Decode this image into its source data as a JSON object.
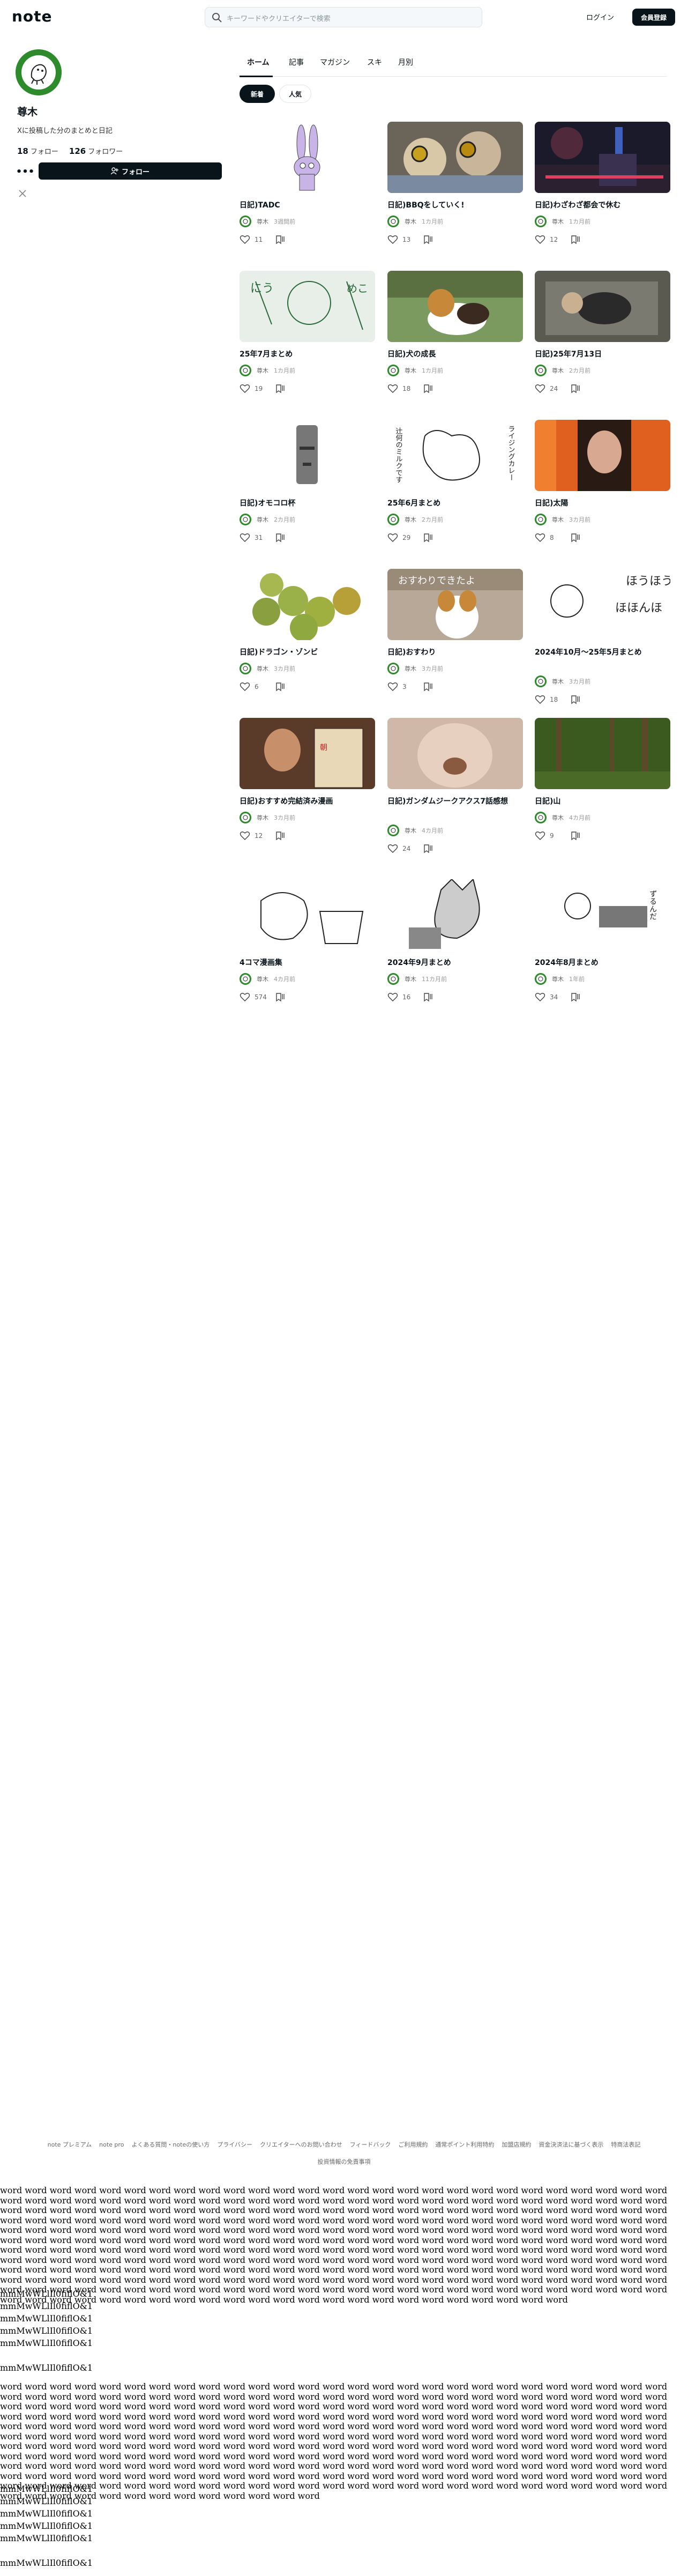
{
  "header": {
    "logo": "note",
    "search_placeholder": "キーワードやクリエイターで検索",
    "login": "ログイン",
    "signup": "会員登録"
  },
  "profile": {
    "name": "尊木",
    "bio": "Xに投稿した分のまとめと日記",
    "following_count": "18",
    "following_label": "フォロー",
    "followers_count": "126",
    "followers_label": "フォロワー",
    "more": "•••",
    "follow_button": "フォロー"
  },
  "tabs": [
    "ホーム",
    "記事",
    "マガジン",
    "スキ",
    "月別"
  ],
  "filters": [
    "新着",
    "人気"
  ],
  "author": "尊木",
  "cards": [
    {
      "title": "日記)TADC",
      "time": "3週間前",
      "likes": "11",
      "thumb": "rabbit"
    },
    {
      "title": "日記)BBQをしていく!",
      "time": "1カ月前",
      "likes": "13",
      "thumb": "bbq"
    },
    {
      "title": "日記)わざわざ都会で休む",
      "time": "1カ月前",
      "likes": "12",
      "thumb": "city"
    },
    {
      "title": "25年7月まとめ",
      "time": "1カ月前",
      "likes": "19",
      "thumb": "sketch"
    },
    {
      "title": "日記)犬の成長",
      "time": "1カ月前",
      "likes": "18",
      "thumb": "dog"
    },
    {
      "title": "日記)25年7月13日",
      "time": "2カ月前",
      "likes": "24",
      "thumb": "table"
    },
    {
      "title": "日記)オモコロ杯",
      "time": "2カ月前",
      "likes": "31",
      "thumb": "moai"
    },
    {
      "title": "25年6月まとめ",
      "time": "2カ月前",
      "likes": "29",
      "thumb": "manga1"
    },
    {
      "title": "日記)太陽",
      "time": "3カ月前",
      "likes": "8",
      "thumb": "sun"
    },
    {
      "title": "日記)ドラゴン・ゾンビ",
      "time": "3カ月前",
      "likes": "6",
      "thumb": "fruit"
    },
    {
      "title": "日記)おすわり",
      "time": "3カ月前",
      "likes": "3",
      "thumb": "puppy"
    },
    {
      "title": "2024年10月〜25年5月まとめ",
      "time": "3カ月前",
      "likes": "18",
      "thumb": "manga2"
    },
    {
      "title": "日記)おすすめ完結済み漫画",
      "time": "3カ月前",
      "likes": "12",
      "thumb": "reader"
    },
    {
      "title": "日記)ガンダムジークアクス7話感想",
      "time": "4カ月前",
      "likes": "24",
      "thumb": "blurdog"
    },
    {
      "title": "日記)山",
      "time": "4カ月前",
      "likes": "9",
      "thumb": "forest"
    },
    {
      "title": "4コマ漫画集",
      "time": "4カ月前",
      "likes": "574",
      "thumb": "manga3"
    },
    {
      "title": "2024年9月まとめ",
      "time": "11カ月前",
      "likes": "16",
      "thumb": "manga4"
    },
    {
      "title": "2024年8月まとめ",
      "time": "1年前",
      "likes": "34",
      "thumb": "manga5"
    }
  ],
  "thumb_text": {
    "puppy": "おすわりできたよ",
    "manga1_a": "辻何のミルクです",
    "manga1_b": "ライジングカレー",
    "manga2": "ほうほう",
    "manga2b": "ほほんほ",
    "manga5": "ずるんだ"
  },
  "footer": [
    "note プレミアム",
    "note pro",
    "よくある質問・noteの使い方",
    "プライバシー",
    "クリエイターへのお問い合わせ",
    "フィードバック",
    "ご利用規約",
    "通常ポイント利用特約",
    "加盟店規約",
    "資金決済法に基づく表示",
    "特商法表記",
    "投資情報の免責事項"
  ],
  "filler_word": "word",
  "mono_lines": [
    "mmMwWLlIl0fiflO&1",
    "mmMwWLlIl0fiflO&1",
    "mmMwWLlIl0fiflO&1",
    "mmMwWLlIl0fiflO&1",
    "mmMwWLlIl0fiflO&1"
  ]
}
